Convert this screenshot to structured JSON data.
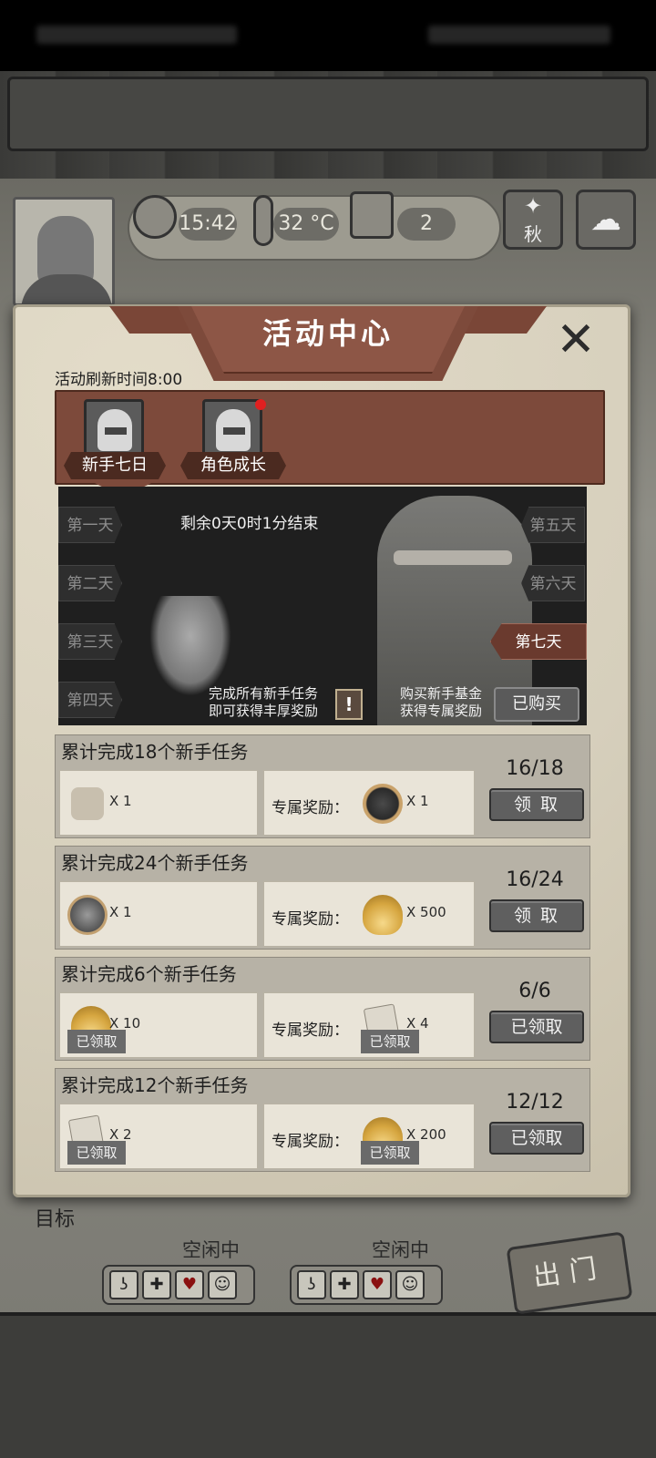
{
  "hud": {
    "time": "15:42",
    "temperature": "32 °C",
    "day_count": "2",
    "season": "秋"
  },
  "background": {
    "goal_label": "目标",
    "survivor1_status": "空闲中",
    "survivor2_status": "空闲中",
    "exit_button": "出门"
  },
  "modal": {
    "title": "活动中心",
    "refresh_time": "活动刷新时间8:00",
    "tabs": [
      {
        "label": "新手七日",
        "active": true
      },
      {
        "label": "角色成长",
        "active": false,
        "has_notification": true
      }
    ],
    "countdown": "剩余0天0时1分结束",
    "days_left": [
      "第一天",
      "第二天",
      "第三天",
      "第四天"
    ],
    "days_right": [
      "第五天",
      "第六天",
      "第七天"
    ],
    "active_day": "第七天",
    "note_left_line1": "完成所有新手任务",
    "note_left_line2": "即可获得丰厚奖励",
    "note_right_line1": "购买新手基金",
    "note_right_line2": "获得专属奖励",
    "bought_button": "已购买",
    "exclusive_label": "专属奖励：",
    "claimed_tag": "已领取",
    "tasks": [
      {
        "title": "累计完成18个新手任务",
        "reward_icon": "shirt-icon",
        "reward_qty": "X 1",
        "exclusive_icon": "seal-badge-icon",
        "exclusive_qty": "X 1",
        "progress": "16/18",
        "button": "领 取",
        "claimed": false
      },
      {
        "title": "累计完成24个新手任务",
        "reward_icon": "fox-badge-icon",
        "reward_qty": "X 1",
        "exclusive_icon": "shell-icon",
        "exclusive_qty": "X 500",
        "progress": "16/24",
        "button": "领 取",
        "claimed": false
      },
      {
        "title": "累计完成6个新手任务",
        "reward_icon": "shell-icon",
        "reward_qty": "X 10",
        "exclusive_icon": "paper-icon",
        "exclusive_qty": "X 4",
        "progress": "6/6",
        "button": "已领取",
        "claimed": true
      },
      {
        "title": "累计完成12个新手任务",
        "reward_icon": "paper-icon",
        "reward_qty": "X 2",
        "exclusive_icon": "shell-icon",
        "exclusive_qty": "X 200",
        "progress": "12/12",
        "button": "已领取",
        "claimed": true
      }
    ]
  }
}
